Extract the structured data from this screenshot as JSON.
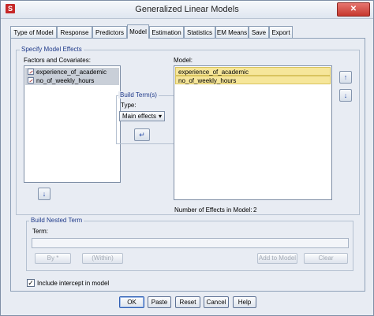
{
  "window": {
    "title": "Generalized Linear Models",
    "app_icon": "spss-icon",
    "close_label": "✕"
  },
  "tabs": [
    {
      "label": "Type of Model"
    },
    {
      "label": "Response"
    },
    {
      "label": "Predictors"
    },
    {
      "label": "Model",
      "active": true
    },
    {
      "label": "Estimation"
    },
    {
      "label": "Statistics"
    },
    {
      "label": "EM Means"
    },
    {
      "label": "Save"
    },
    {
      "label": "Export"
    }
  ],
  "specify": {
    "group_label": "Specify Model Effects",
    "factors_label": "Factors and Covariates:",
    "factors": [
      "experience_of_academic",
      "no_of_weekly_hours"
    ],
    "model_label": "Model:",
    "model_items": [
      "experience_of_academic",
      "no_of_weekly_hours"
    ],
    "build_terms": {
      "group_label": "Build Term(s)",
      "type_label": "Type:",
      "type_value": "Main effects"
    },
    "effects_count_label": "Number of Effects in Model:",
    "effects_count": "2"
  },
  "nested": {
    "group_label": "Build Nested Term",
    "term_label": "Term:",
    "term_value": "",
    "by_button": "By *",
    "within_button": "(Within)",
    "add_button": "Add to Model",
    "clear_button": "Clear"
  },
  "intercept": {
    "label": "Include intercept in model",
    "checked": true
  },
  "buttons": {
    "ok": "OK",
    "paste": "Paste",
    "reset": "Reset",
    "cancel": "Cancel",
    "help": "Help"
  }
}
